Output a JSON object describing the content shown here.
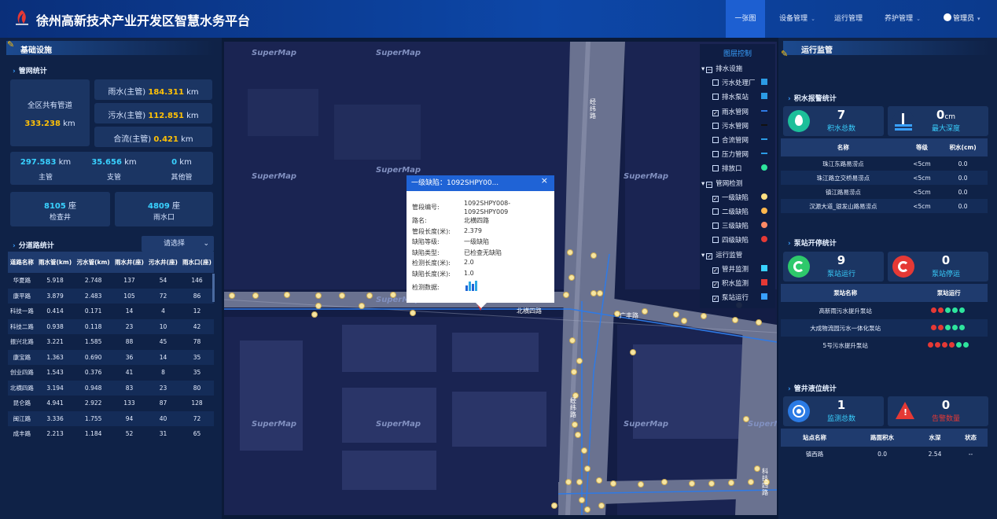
{
  "header": {
    "title": "徐州高新技术产业开发区智慧水务平台",
    "nav": [
      "一张图",
      "设备管理",
      "运行管理",
      "养护管理"
    ],
    "user": "管理员"
  },
  "left": {
    "title": "基础设施",
    "pipe_stats_title": "管网统计",
    "total_label": "全区共有管道",
    "total_value": "333.238",
    "km": "km",
    "rain_label": "雨水(主管)",
    "rain_value": "184.311",
    "sewage_label": "污水(主管)",
    "sewage_value": "112.851",
    "combined_label": "合流(主管)",
    "combined_value": "0.421",
    "main_value": "297.583",
    "main_label": "主管",
    "branch_value": "35.656",
    "branch_label": "支管",
    "other_value": "0",
    "other_label": "其他管",
    "well_value": "8105",
    "well_unit": "座",
    "well_label": "检查井",
    "inlet_value": "4809",
    "inlet_unit": "座",
    "inlet_label": "雨水口",
    "road_stats_title": "分道路统计",
    "select_label": "请选择",
    "table_headers": [
      "道路名称",
      "雨水管(km)",
      "污水管(km)",
      "雨水井(座)",
      "污水井(座)",
      "雨水口(座)"
    ],
    "rows": [
      [
        "华夏路",
        "5.918",
        "2.748",
        "137",
        "54",
        "146"
      ],
      [
        "康平路",
        "3.879",
        "2.483",
        "105",
        "72",
        "86"
      ],
      [
        "科技一路",
        "0.414",
        "0.171",
        "14",
        "4",
        "12"
      ],
      [
        "科技二路",
        "0.938",
        "0.118",
        "23",
        "10",
        "42"
      ],
      [
        "振兴北路",
        "3.221",
        "1.585",
        "88",
        "45",
        "78"
      ],
      [
        "康宝路",
        "1.363",
        "0.690",
        "36",
        "14",
        "35"
      ],
      [
        "创业四路",
        "1.543",
        "0.376",
        "41",
        "8",
        "35"
      ],
      [
        "北横四路",
        "3.194",
        "0.948",
        "83",
        "23",
        "80"
      ],
      [
        "昆仑路",
        "4.941",
        "2.922",
        "133",
        "87",
        "128"
      ],
      [
        "闽江路",
        "3.336",
        "1.755",
        "94",
        "40",
        "72"
      ],
      [
        "成丰路",
        "2.213",
        "1.184",
        "52",
        "31",
        "65"
      ]
    ]
  },
  "map": {
    "watermark": "SuperMap",
    "road_labels": [
      "经纬路",
      "北横四路",
      "广丰路",
      "经纬路",
      "科技",
      "四路"
    ],
    "layer_title": "图层控制",
    "layers": [
      {
        "label": "排水设施",
        "checked": false,
        "group": true
      },
      {
        "label": "污水处理厂",
        "checked": false,
        "group": false
      },
      {
        "label": "排水泵站",
        "checked": false,
        "group": false
      },
      {
        "label": "雨水管网",
        "checked": true,
        "group": false
      },
      {
        "label": "污水管网",
        "checked": false,
        "group": false
      },
      {
        "label": "合流管网",
        "checked": false,
        "group": false
      },
      {
        "label": "压力管网",
        "checked": false,
        "group": false
      },
      {
        "label": "排放口",
        "checked": false,
        "group": false
      },
      {
        "label": "管网检测",
        "checked": false,
        "group": true
      },
      {
        "label": "一级缺陷",
        "checked": true,
        "group": false
      },
      {
        "label": "二级缺陷",
        "checked": false,
        "group": false
      },
      {
        "label": "三级缺陷",
        "checked": false,
        "group": false
      },
      {
        "label": "四级缺陷",
        "checked": false,
        "group": false
      },
      {
        "label": "运行监管",
        "checked": true,
        "group": true
      },
      {
        "label": "管井监测",
        "checked": true,
        "group": false
      },
      {
        "label": "积水监测",
        "checked": true,
        "group": false
      },
      {
        "label": "泵站运行",
        "checked": true,
        "group": false
      }
    ],
    "popup": {
      "title": "一级缺陷：1092SHPY00...",
      "fields": [
        {
          "k": "管段编号:",
          "v": "1092SHPY008-1092SHPY009"
        },
        {
          "k": "路名:",
          "v": "北横四路"
        },
        {
          "k": "管段长度(米):",
          "v": "2.379"
        },
        {
          "k": "缺陷等级:",
          "v": "一级缺陷"
        },
        {
          "k": "缺陷类型:",
          "v": "已检查无缺陷"
        },
        {
          "k": "检测长度(米):",
          "v": "2.0"
        },
        {
          "k": "缺陷长度(米):",
          "v": "1.0"
        },
        {
          "k": "检测数据:",
          "v": ""
        }
      ]
    }
  },
  "right": {
    "title": "运行监管",
    "ponding_title": "积水报警统计",
    "ponding_total_value": "7",
    "ponding_total_label": "积水总数",
    "max_depth_value": "0",
    "max_depth_unit": "cm",
    "max_depth_label": "最大深度",
    "ponding_headers": [
      "名称",
      "等级",
      "积水(cm)"
    ],
    "ponding_rows": [
      [
        "珠江东路易涝点",
        "<5cm",
        "0.0"
      ],
      [
        "珠江路立交桥易涝点",
        "<5cm",
        "0.0"
      ],
      [
        "镇江路易涝点",
        "<5cm",
        "0.0"
      ],
      [
        "汉源大道_银发山路易涝点",
        "<5cm",
        "0.0"
      ]
    ],
    "pump_title": "泵站开停统计",
    "pump_running_value": "9",
    "pump_running_label": "泵站运行",
    "pump_stopped_value": "0",
    "pump_stopped_label": "泵站停运",
    "pump_headers": [
      "泵站名称",
      "泵站运行"
    ],
    "pump_rows": [
      {
        "name": "高新雨污水提升泵站",
        "dots": [
          "#e53935",
          "#e53935",
          "#2ee59d",
          "#2ee59d",
          "#2ee59d"
        ]
      },
      {
        "name": "大成物流园污水一体化泵站",
        "dots": [
          "#e53935",
          "#e53935",
          "#2ee59d",
          "#2ee59d",
          "#2ee59d"
        ]
      },
      {
        "name": "5号污水提升泵站",
        "dots": [
          "#e53935",
          "#e53935",
          "#e53935",
          "#e53935",
          "#2ee59d",
          "#2ee59d"
        ]
      }
    ],
    "well_title": "管井液位统计",
    "monitor_value": "1",
    "monitor_label": "监测总数",
    "alarm_value": "0",
    "alarm_label": "告警数量",
    "well_headers": [
      "站点名称",
      "路面积水",
      "水深",
      "状态"
    ],
    "well_rows": [
      [
        "镇西路",
        "0.0",
        "2.54",
        "--"
      ]
    ]
  }
}
